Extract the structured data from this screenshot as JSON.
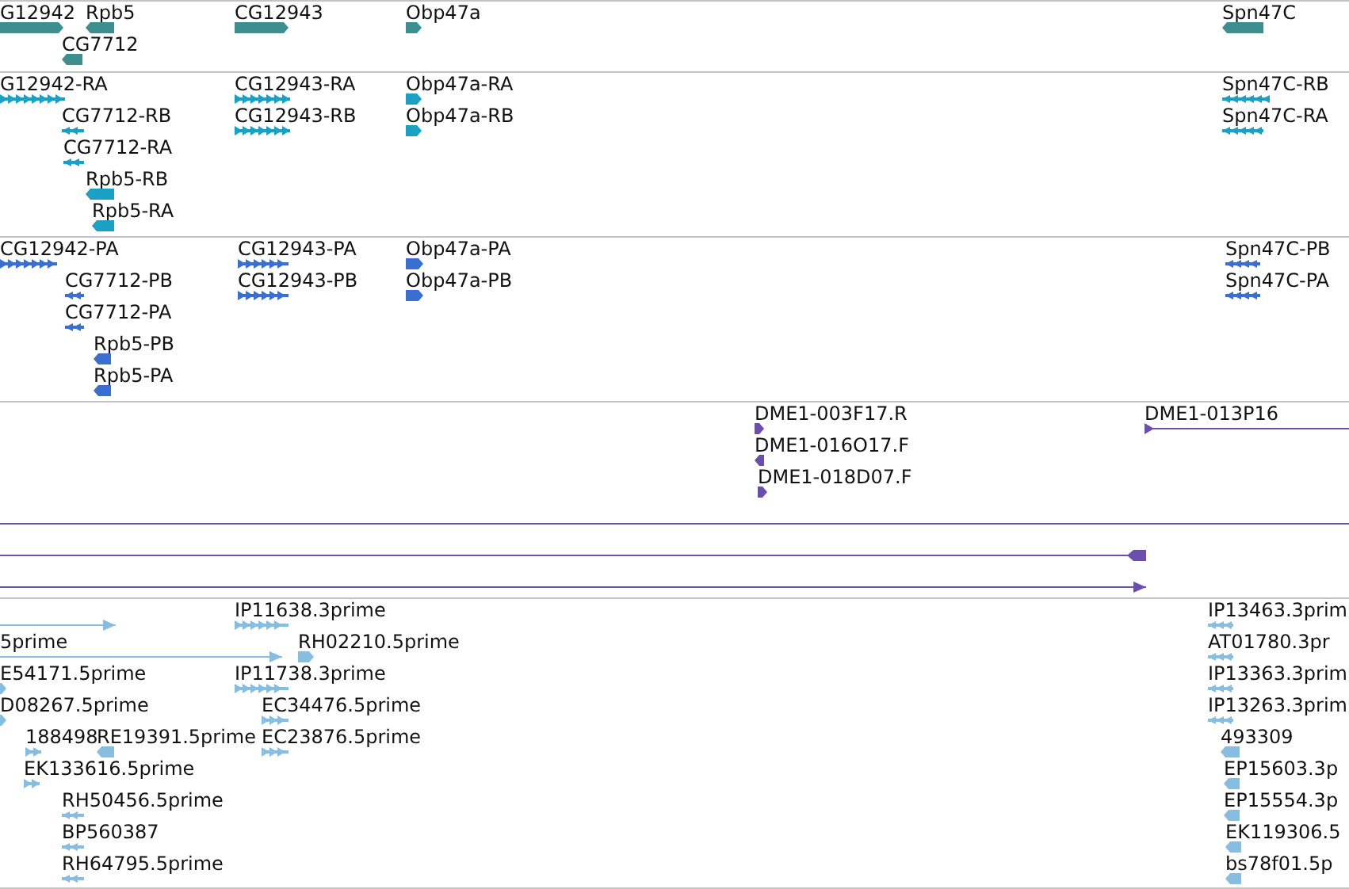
{
  "tracks": [
    {
      "color": "#3d8f8f",
      "features": [
        {
          "label": "G12942",
          "kind": "solid",
          "reverse": false
        },
        {
          "label": "Rpb5",
          "kind": "solid",
          "reverse": true
        },
        {
          "label": "CG7712",
          "kind": "solid",
          "reverse": true
        },
        {
          "label": "CG12943",
          "kind": "solid",
          "reverse": false
        },
        {
          "label": "Obp47a",
          "kind": "solid",
          "reverse": false
        },
        {
          "label": "Spn47C",
          "kind": "solid",
          "reverse": true
        }
      ]
    },
    {
      "color": "#19a0c4",
      "features": [
        {
          "label": "G12942-RA",
          "kind": "exons",
          "reverse": false
        },
        {
          "label": "CG7712-RB",
          "kind": "exons",
          "reverse": true
        },
        {
          "label": "CG7712-RA",
          "kind": "exons",
          "reverse": true
        },
        {
          "label": "Rpb5-RB",
          "kind": "solid",
          "reverse": true
        },
        {
          "label": "Rpb5-RA",
          "kind": "solid",
          "reverse": true
        },
        {
          "label": "CG12943-RA",
          "kind": "exons",
          "reverse": false
        },
        {
          "label": "CG12943-RB",
          "kind": "exons",
          "reverse": false
        },
        {
          "label": "Obp47a-RA",
          "kind": "solid",
          "reverse": false
        },
        {
          "label": "Obp47a-RB",
          "kind": "solid",
          "reverse": false
        },
        {
          "label": "Spn47C-RB",
          "kind": "exons",
          "reverse": true
        },
        {
          "label": "Spn47C-RA",
          "kind": "exons",
          "reverse": true
        }
      ]
    },
    {
      "color": "#3a6fd2",
      "features": [
        {
          "label": "CG12942-PA",
          "kind": "exons",
          "reverse": false
        },
        {
          "label": "CG7712-PB",
          "kind": "exons",
          "reverse": true
        },
        {
          "label": "CG7712-PA",
          "kind": "exons",
          "reverse": true
        },
        {
          "label": "Rpb5-PB",
          "kind": "solid",
          "reverse": true
        },
        {
          "label": "Rpb5-PA",
          "kind": "solid",
          "reverse": true
        },
        {
          "label": "CG12943-PA",
          "kind": "exons",
          "reverse": false
        },
        {
          "label": "CG12943-PB",
          "kind": "exons",
          "reverse": false
        },
        {
          "label": "Obp47a-PA",
          "kind": "solid",
          "reverse": false
        },
        {
          "label": "Obp47a-PB",
          "kind": "solid",
          "reverse": false
        },
        {
          "label": "Spn47C-PB",
          "kind": "exons",
          "reverse": true
        },
        {
          "label": "Spn47C-PA",
          "kind": "exons",
          "reverse": true
        }
      ]
    },
    {
      "color": "#6a4fae",
      "features": [
        {
          "label": "DME1-003F17.R",
          "kind": "solid",
          "reverse": false
        },
        {
          "label": "DME1-016O17.F",
          "kind": "solid",
          "reverse": true
        },
        {
          "label": "DME1-018D07.F",
          "kind": "solid",
          "reverse": false
        },
        {
          "label": "DME1-013P16",
          "kind": "line",
          "reverse": false
        },
        {
          "kind": "line"
        },
        {
          "kind": "line",
          "reverse": true
        },
        {
          "kind": "line",
          "reverse": false
        }
      ]
    },
    {
      "color": "#88bde2",
      "features": [
        {
          "kind": "line",
          "reverse": false
        },
        {
          "label": "IP11638.3prime",
          "kind": "exons",
          "reverse": false
        },
        {
          "label": "IP13463.3prim",
          "kind": "exons",
          "reverse": true
        },
        {
          "label": "5prime",
          "kind": "line",
          "reverse": false
        },
        {
          "label": "RH02210.5prime",
          "kind": "solid",
          "reverse": false
        },
        {
          "label": "AT01780.3pr",
          "kind": "exons",
          "reverse": true
        },
        {
          "label": "E54171.5prime",
          "kind": "solid",
          "reverse": false
        },
        {
          "label": "IP11738.3prime",
          "kind": "exons",
          "reverse": false
        },
        {
          "label": "IP13363.3prim",
          "kind": "exons",
          "reverse": true
        },
        {
          "label": "D08267.5prime",
          "kind": "solid",
          "reverse": false
        },
        {
          "label": "EC34476.5prime",
          "kind": "exons",
          "reverse": false
        },
        {
          "label": "IP13263.3prim",
          "kind": "exons",
          "reverse": true
        },
        {
          "label": "188498",
          "kind": "exons",
          "reverse": false
        },
        {
          "label": "RE19391.5prime",
          "kind": "solid",
          "reverse": true
        },
        {
          "label": "EC23876.5prime",
          "kind": "exons",
          "reverse": false
        },
        {
          "label": "493309",
          "kind": "solid",
          "reverse": true
        },
        {
          "label": "EK133616.5prime",
          "kind": "exons",
          "reverse": false
        },
        {
          "label": "EP15603.3p",
          "kind": "solid",
          "reverse": true
        },
        {
          "label": "RH50456.5prime",
          "kind": "exons",
          "reverse": true
        },
        {
          "label": "EP15554.3p",
          "kind": "solid",
          "reverse": true
        },
        {
          "label": "BP560387",
          "kind": "exons",
          "reverse": true
        },
        {
          "label": "EK119306.5",
          "kind": "solid",
          "reverse": true
        },
        {
          "label": "RH64795.5prime",
          "kind": "exons",
          "reverse": true
        },
        {
          "label": "bs78f01.5p",
          "kind": "solid",
          "reverse": true
        }
      ]
    }
  ]
}
